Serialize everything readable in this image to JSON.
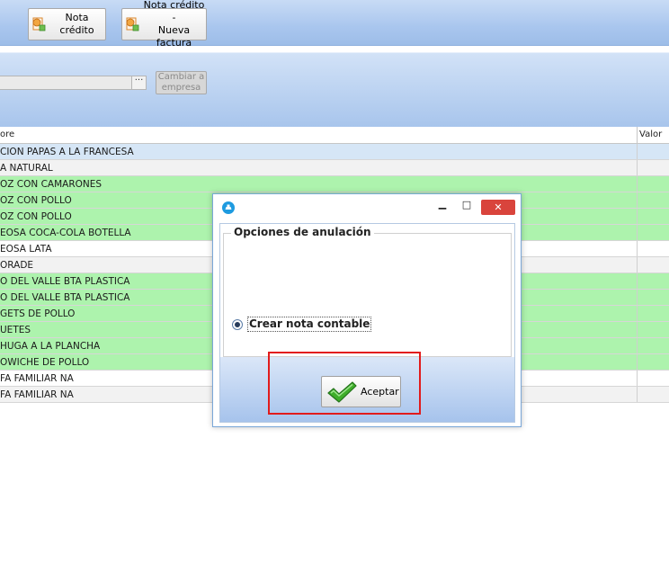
{
  "toolbar": {
    "nota_credito": "Nota crédito",
    "nota_credito_nueva_line1": "Nota crédito -",
    "nota_credito_nueva_line2": "Nueva factura"
  },
  "filter": {
    "dots_label": "···",
    "cambiar_line1": "Cambiar a",
    "cambiar_line2": "empresa"
  },
  "grid": {
    "col_name": "ore",
    "col_valor": "Valor",
    "rows": [
      {
        "name": "CION PAPAS A LA FRANCESA",
        "tone": "blue"
      },
      {
        "name": "A NATURAL",
        "tone": "gray"
      },
      {
        "name": "OZ CON CAMARONES",
        "tone": "green"
      },
      {
        "name": "OZ CON POLLO",
        "tone": "green"
      },
      {
        "name": "OZ CON POLLO",
        "tone": "green"
      },
      {
        "name": "EOSA COCA-COLA BOTELLA",
        "tone": "green"
      },
      {
        "name": "EOSA LATA",
        "tone": "white"
      },
      {
        "name": "ORADE",
        "tone": "gray"
      },
      {
        "name": "O DEL VALLE BTA PLASTICA",
        "tone": "green"
      },
      {
        "name": "O DEL VALLE BTA PLASTICA",
        "tone": "green"
      },
      {
        "name": "GETS DE POLLO",
        "tone": "green"
      },
      {
        "name": "UETES",
        "tone": "green"
      },
      {
        "name": "HUGA A LA PLANCHA",
        "tone": "green"
      },
      {
        "name": "OWICHE DE  POLLO",
        "tone": "green"
      },
      {
        "name": "FA FAMILIAR NA",
        "tone": "white"
      },
      {
        "name": "FA FAMILIAR NA",
        "tone": "gray"
      }
    ]
  },
  "dialog": {
    "minimize": "▁",
    "maximize": "□",
    "close": "✕",
    "group_title": "Opciones de anulación",
    "radio_label": "Crear nota contable",
    "ok_label": "Aceptar"
  },
  "colors": {
    "row_green": "#adf3ad",
    "highlight": "#e21b1b",
    "close_red": "#d9443c"
  }
}
